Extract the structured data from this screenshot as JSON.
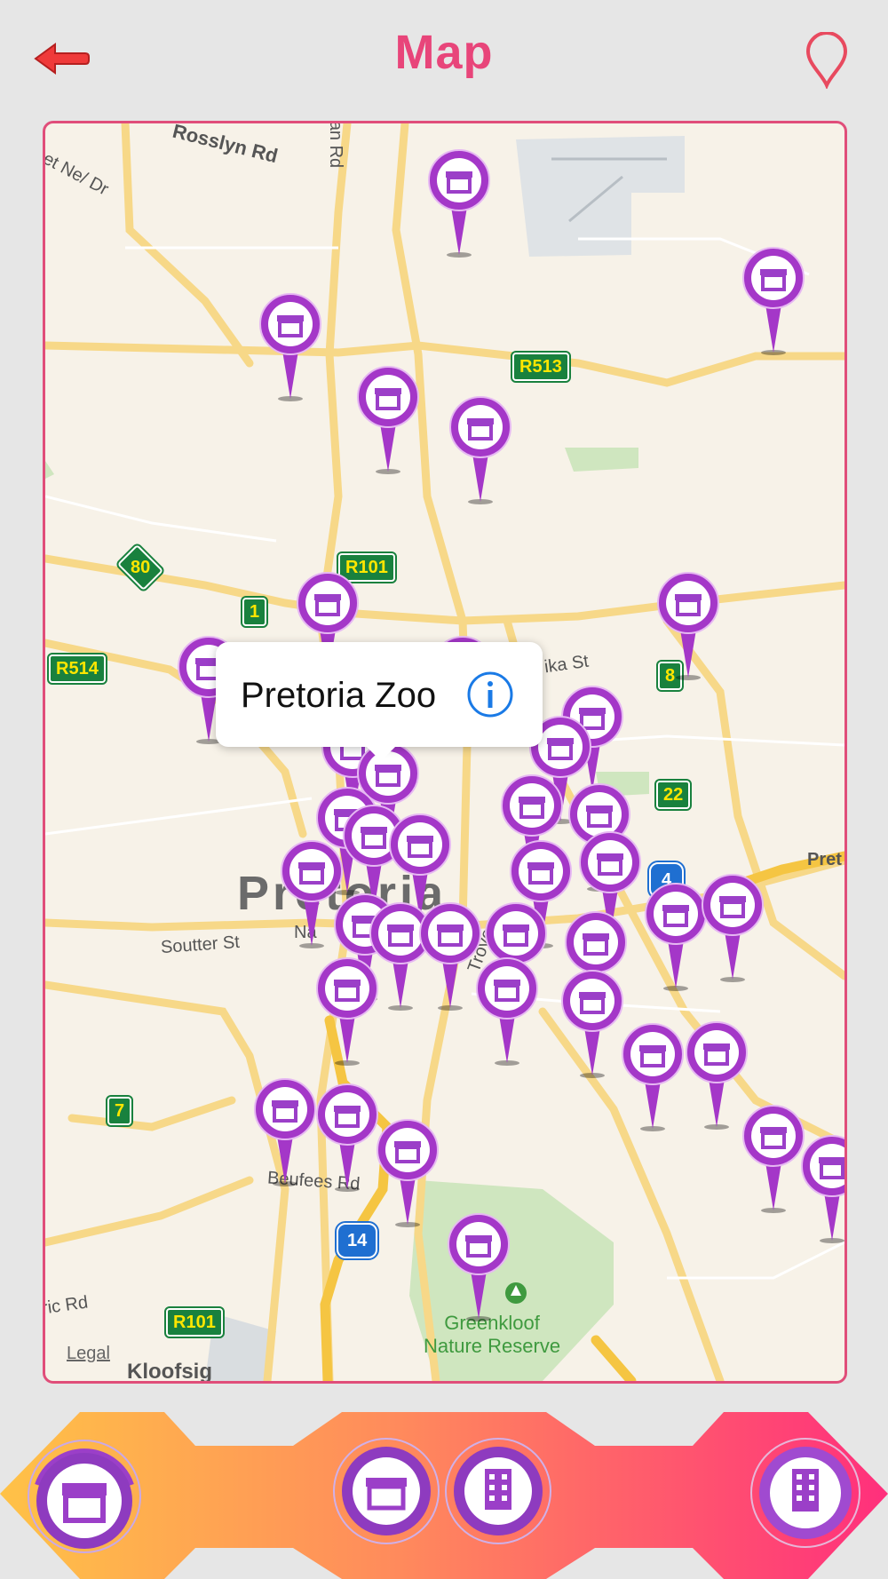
{
  "header": {
    "title": "Map",
    "back_icon": "back-arrow-icon",
    "location_icon": "location-pin-icon"
  },
  "map": {
    "road_labels": [
      "Rosslyn Rd",
      "et Ne/ Dr",
      "an Rd",
      "Soutter St",
      "Na",
      "Troye",
      "Beufees Rd",
      "ric Rd",
      "ika St",
      "Pret"
    ],
    "route_shields": [
      "R513",
      "R101",
      "1",
      "R514",
      "80",
      "8",
      "22",
      "7",
      "R101",
      "4",
      "14"
    ],
    "city_label": "Pretoria",
    "park_label": "Greenkloof\nNature Reserve",
    "suburb_label": "Kloofsig",
    "legal_link": "Legal",
    "pin_icon": "shop-pin-icon",
    "callout": {
      "title": "Pretoria Zoo",
      "info_icon": "info-icon"
    }
  },
  "tabs": [
    {
      "name": "tab-shops-primary",
      "icon": "shop-icon",
      "selected": true
    },
    {
      "name": "tab-shops",
      "icon": "shop-icon",
      "selected": false
    },
    {
      "name": "tab-buildings",
      "icon": "building-icon",
      "selected": false
    },
    {
      "name": "tab-buildings-alt",
      "icon": "building-icon",
      "selected": false
    }
  ],
  "colors": {
    "accent": "#e8457a",
    "pin_purple": "#a437c8",
    "bar_left": "#ffc247",
    "bar_right": "#ff2f7c"
  }
}
